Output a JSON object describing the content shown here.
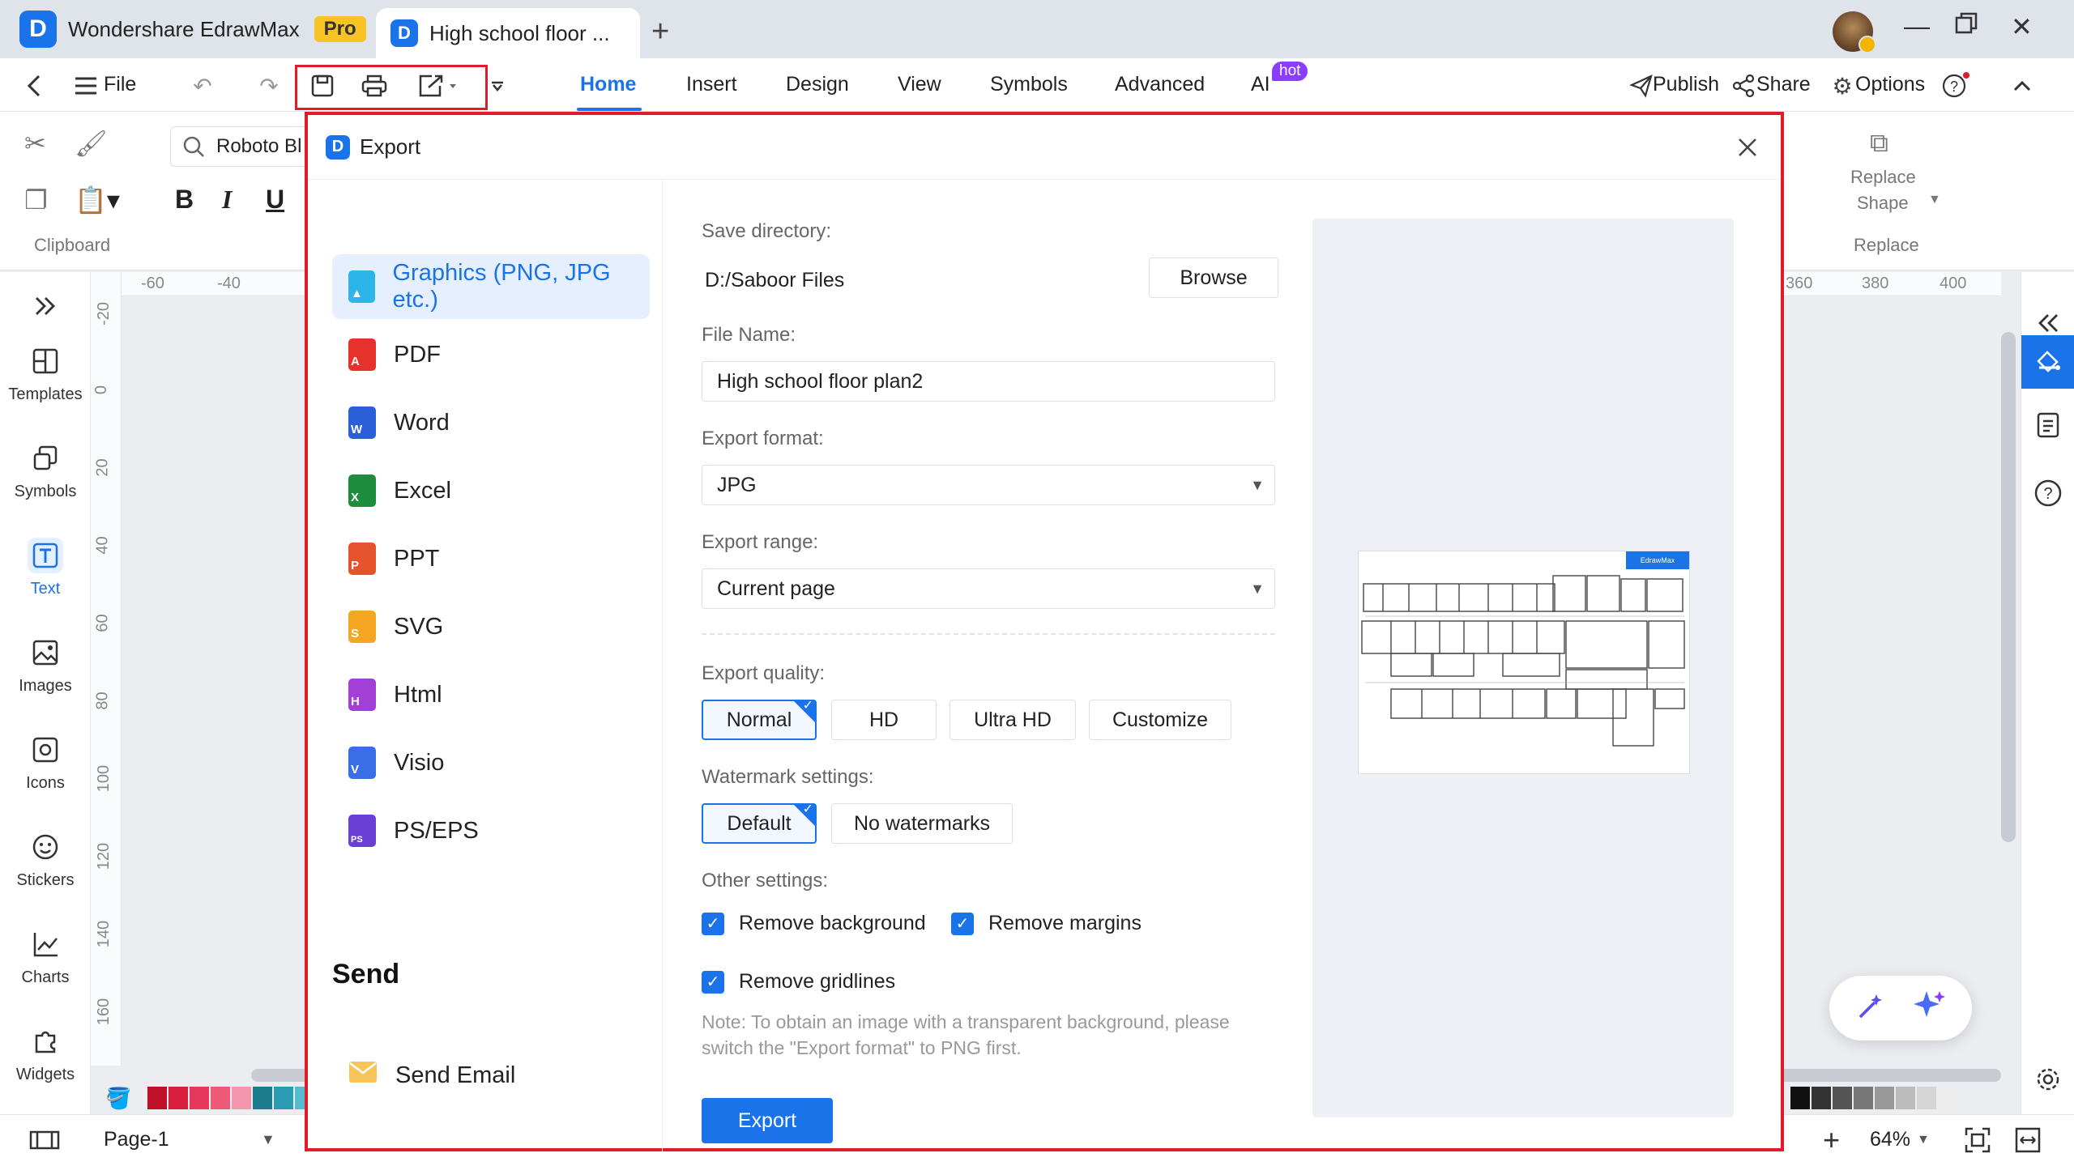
{
  "titlebar": {
    "app_name": "Wondershare EdrawMax",
    "pro_badge": "Pro",
    "doc_tab_title": "High school floor ...",
    "new_tab": "+"
  },
  "menubar": {
    "file": "File",
    "tabs": [
      "Home",
      "Insert",
      "Design",
      "View",
      "Symbols",
      "Advanced",
      "AI"
    ],
    "active_tab": "Home",
    "hot_badge": "hot",
    "publish": "Publish",
    "share": "Share",
    "options": "Options"
  },
  "ribbon": {
    "font_name": "Roboto Bl",
    "clipboard_label": "Clipboard",
    "replace_shape": [
      "Replace",
      "Shape"
    ],
    "replace_label": "Replace"
  },
  "left_sidebar": [
    {
      "label": "Templates"
    },
    {
      "label": "Symbols"
    },
    {
      "label": "Text"
    },
    {
      "label": "Images"
    },
    {
      "label": "Icons"
    },
    {
      "label": "Stickers"
    },
    {
      "label": "Charts"
    },
    {
      "label": "Widgets"
    }
  ],
  "rulers": {
    "h_left": [
      "-60",
      "-40"
    ],
    "h_right": [
      "360",
      "380",
      "400"
    ],
    "v": [
      "-20",
      "0",
      "20",
      "40",
      "60",
      "80",
      "100",
      "120",
      "140",
      "160"
    ]
  },
  "statusbar": {
    "page": "Page-1",
    "zoom": "64%"
  },
  "colors": {
    "accent": "#1a73e8",
    "highlight_border": "#e21b2a"
  },
  "dialog": {
    "title": "Export",
    "formats": [
      {
        "label": "Graphics (PNG, JPG etc.)",
        "color": "#2cb5e8"
      },
      {
        "label": "PDF",
        "color": "#e5322d"
      },
      {
        "label": "Word",
        "color": "#2b5fd9"
      },
      {
        "label": "Excel",
        "color": "#1e8e3e"
      },
      {
        "label": "PPT",
        "color": "#e5532d"
      },
      {
        "label": "SVG",
        "color": "#f5a623"
      },
      {
        "label": "Html",
        "color": "#a13fd6"
      },
      {
        "label": "Visio",
        "color": "#3a6ee8"
      },
      {
        "label": "PS/EPS",
        "color": "#6a3fd6"
      }
    ],
    "selected_format": "Graphics (PNG, JPG etc.)",
    "send_heading": "Send",
    "send_email": "Send Email",
    "save_directory_label": "Save directory:",
    "save_directory": "D:/Saboor Files",
    "browse": "Browse",
    "file_name_label": "File Name:",
    "file_name": "High school floor plan2",
    "export_format_label": "Export format:",
    "export_format": "JPG",
    "export_range_label": "Export range:",
    "export_range": "Current page",
    "quality_label": "Export quality:",
    "quality_options": [
      "Normal",
      "HD",
      "Ultra HD",
      "Customize"
    ],
    "quality_selected": "Normal",
    "watermark_label": "Watermark settings:",
    "watermark_options": [
      "Default",
      "No watermarks"
    ],
    "watermark_selected": "Default",
    "other_label": "Other settings:",
    "remove_background": "Remove background",
    "remove_margins": "Remove margins",
    "remove_gridlines": "Remove gridlines",
    "note": "Note: To obtain an image with a transparent background, please switch the \"Export format\" to PNG first.",
    "export_button": "Export",
    "preview_watermark": "EdrawMax"
  }
}
